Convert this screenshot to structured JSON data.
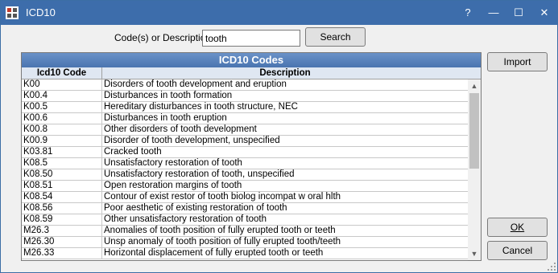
{
  "window": {
    "title": "ICD10",
    "help_glyph": "?",
    "minimize_glyph": "—",
    "maximize_glyph": "☐",
    "close_glyph": "✕",
    "app_icon": "grid-app-icon"
  },
  "search": {
    "label": "Code(s) or Description",
    "value": "tooth",
    "button_label": "Search"
  },
  "grid": {
    "title": "ICD10 Codes",
    "columns": [
      "Icd10 Code",
      "Description"
    ],
    "rows": [
      {
        "code": "K00",
        "desc": "Disorders of tooth development and eruption"
      },
      {
        "code": "K00.4",
        "desc": "Disturbances in tooth formation"
      },
      {
        "code": "K00.5",
        "desc": "Hereditary disturbances in tooth structure, NEC"
      },
      {
        "code": "K00.6",
        "desc": "Disturbances in tooth eruption"
      },
      {
        "code": "K00.8",
        "desc": "Other disorders of tooth development"
      },
      {
        "code": "K00.9",
        "desc": "Disorder of tooth development, unspecified"
      },
      {
        "code": "K03.81",
        "desc": "Cracked tooth"
      },
      {
        "code": "K08.5",
        "desc": "Unsatisfactory restoration of tooth"
      },
      {
        "code": "K08.50",
        "desc": "Unsatisfactory restoration of tooth, unspecified"
      },
      {
        "code": "K08.51",
        "desc": "Open restoration margins of tooth"
      },
      {
        "code": "K08.54",
        "desc": "Contour of exist restor of tooth biolog incompat w oral hlth"
      },
      {
        "code": "K08.56",
        "desc": "Poor aesthetic of existing restoration of tooth"
      },
      {
        "code": "K08.59",
        "desc": "Other unsatisfactory restoration of tooth"
      },
      {
        "code": "M26.3",
        "desc": "Anomalies of tooth position of fully erupted tooth or teeth"
      },
      {
        "code": "M26.30",
        "desc": "Unsp anomaly of tooth position of fully erupted tooth/teeth"
      },
      {
        "code": "M26.33",
        "desc": "Horizontal displacement of fully erupted tooth or teeth"
      }
    ]
  },
  "buttons": {
    "import": "Import",
    "ok": "OK",
    "cancel": "Cancel"
  },
  "colors": {
    "titlebar": "#3d6dab",
    "grid_header": "#4a74b0"
  }
}
